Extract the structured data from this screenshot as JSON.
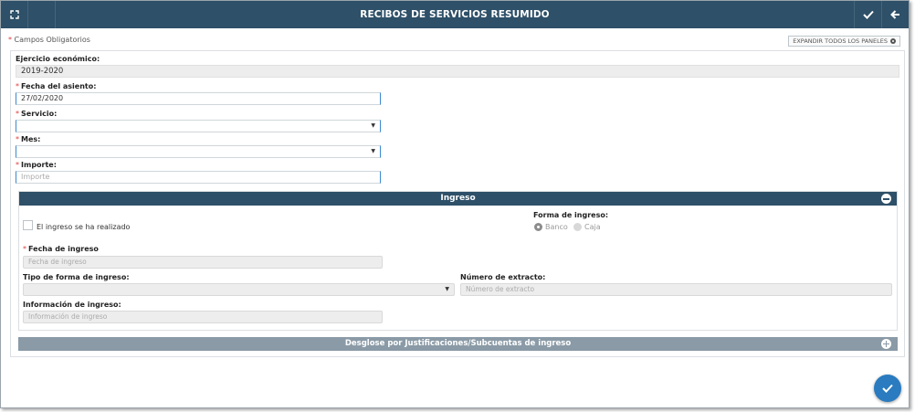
{
  "header": {
    "title": "RECIBOS DE SERVICIOS RESUMIDO",
    "icons": {
      "fullscreen": "fullscreen-icon",
      "save": "check-icon",
      "back": "arrow-left-icon"
    }
  },
  "required_note": {
    "star": "*",
    "text": "Campos Obligatorios"
  },
  "expand_button": {
    "label": "EXPANDIR TODOS LOS PANELES",
    "icon": "gear-icon"
  },
  "form": {
    "ejercicio": {
      "label": "Ejercicio económico:",
      "value": "2019-2020"
    },
    "fecha_asiento": {
      "label": "Fecha del asiento:",
      "value": "27/02/2020"
    },
    "servicio": {
      "label": "Servicio:",
      "value": ""
    },
    "mes": {
      "label": "Mes:",
      "value": ""
    },
    "importe": {
      "label": "Importe:",
      "placeholder": "Importe"
    }
  },
  "ingreso_panel": {
    "title": "Ingreso",
    "checkbox_label": "El ingreso se ha realizado",
    "forma_label": "Forma de ingreso:",
    "forma_options": [
      "Banco",
      "Caja"
    ],
    "forma_selected": "Banco",
    "fecha_ingreso": {
      "label": "Fecha de ingreso",
      "placeholder": "Fecha de ingreso"
    },
    "tipo_forma": {
      "label": "Tipo de forma de ingreso:",
      "value": ""
    },
    "numero_extracto": {
      "label": "Número de extracto:",
      "placeholder": "Número de extracto"
    },
    "info_ingreso": {
      "label": "Información de ingreso:",
      "placeholder": "Información de ingreso"
    }
  },
  "desglose_panel": {
    "title": "Desglose por Justificaciones/Subcuentas de ingreso"
  },
  "colors": {
    "header": "#2e5068",
    "accent": "#2a7bbf",
    "required": "#e03a3a",
    "collapsed_panel": "#8a9aa6"
  }
}
